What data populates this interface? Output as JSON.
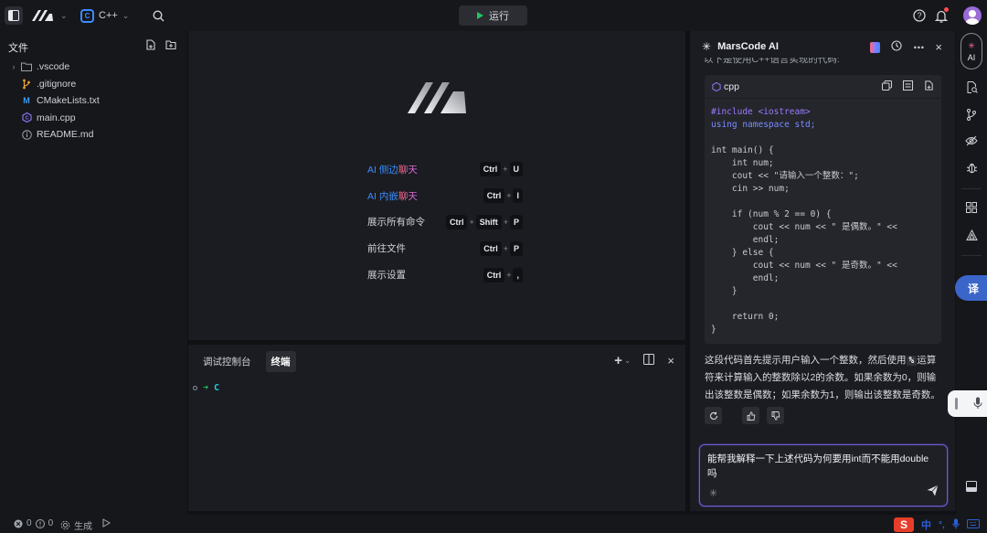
{
  "titlebar": {
    "language": "C++",
    "run_label": "运行"
  },
  "explorer": {
    "title": "文件",
    "items": [
      {
        "name": ".vscode",
        "type": "folder"
      },
      {
        "name": ".gitignore",
        "type": "git"
      },
      {
        "name": "CMakeLists.txt",
        "type": "cmake"
      },
      {
        "name": "main.cpp",
        "type": "cpp"
      },
      {
        "name": "README.md",
        "type": "info"
      }
    ]
  },
  "welcome": {
    "shortcuts": [
      {
        "label_prefix": "AI ",
        "label_main": "侧边",
        "label_accent": "聊天",
        "keys": [
          "Ctrl",
          "U"
        ]
      },
      {
        "label_prefix": "AI ",
        "label_main": "内嵌",
        "label_accent": "聊天",
        "keys": [
          "Ctrl",
          "I"
        ]
      },
      {
        "label": "展示所有命令",
        "keys": [
          "Ctrl",
          "Shift",
          "P"
        ]
      },
      {
        "label": "前往文件",
        "keys": [
          "Ctrl",
          "P"
        ]
      },
      {
        "label": "展示设置",
        "keys": [
          "Ctrl",
          ","
        ]
      }
    ]
  },
  "panel": {
    "tabs": [
      "调试控制台",
      "终端"
    ],
    "active_tab": "终端",
    "prompt_arrow": "➜",
    "prompt_dir": "C"
  },
  "ai": {
    "title": "MarsCode AI",
    "cut_text": "以下是使用C++语言实现的代码:",
    "code_lang": "cpp",
    "code_lines": [
      "#include <iostream>",
      "using namespace std;",
      "",
      "int main() {",
      "    int num;",
      "    cout << \"请输入一个整数：\";",
      "    cin >> num;",
      "",
      "    if (num % 2 == 0) {",
      "        cout << num << \" 是偶数。\" <<",
      "        endl;",
      "    } else {",
      "        cout << num << \" 是奇数。\" <<",
      "        endl;",
      "    }",
      "",
      "    return 0;",
      "}"
    ],
    "explanation_before": "这段代码首先提示用户输入一个整数，然后使用",
    "explanation_code": "%",
    "explanation_after": "运算符来计算输入的整数除以2的余数。如果余数为0，则输出该整数是偶数；如果余数为1，则输出该整数是奇数。",
    "input_value": "能帮我解释一下上述代码为何要用int而不能用double吗"
  },
  "activity": {
    "ai_label": "AI",
    "translate_label": "译"
  },
  "statusbar": {
    "errors": "0",
    "warnings": "0",
    "build_label": "生成",
    "ime_label": "中"
  },
  "colors": {
    "accent_blue": "#3a8cff",
    "run_green": "#22c55e",
    "ai_border": "#6d5bd8"
  }
}
